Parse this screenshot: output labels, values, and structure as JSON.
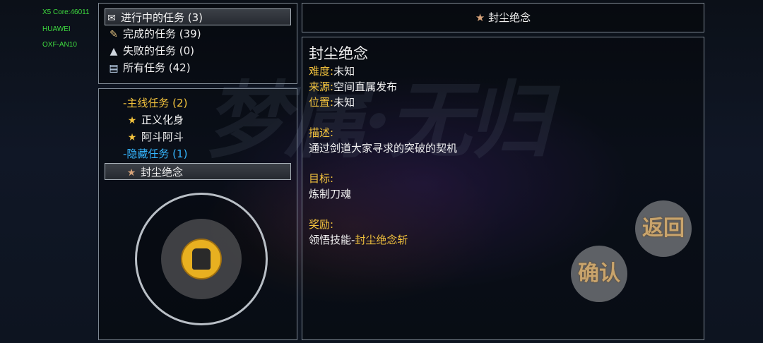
{
  "device": {
    "line1": "X5 Core:46011",
    "line2": "HUAWEI",
    "line3": "OXF-AN10"
  },
  "background_title": "梦属·无归",
  "filters": [
    {
      "label": "进行中的任务 (3)",
      "icon": "scroll-icon",
      "selected": true
    },
    {
      "label": "完成的任务 (39)",
      "icon": "rolled-scroll-icon",
      "selected": false
    },
    {
      "label": "失败的任务 (0)",
      "icon": "flask-icon",
      "selected": false
    },
    {
      "label": "所有任务 (42)",
      "icon": "book-icon",
      "selected": false
    }
  ],
  "quest_tree": {
    "main_group": "-主线任务 (2)",
    "main_items": [
      "正义化身",
      "阿斗阿斗"
    ],
    "hidden_group": "-隐藏任务 (1)",
    "hidden_items": [
      "封尘绝念"
    ]
  },
  "header": {
    "title": "封尘绝念"
  },
  "detail": {
    "title": "封尘绝念",
    "difficulty_label": "难度:",
    "difficulty_value": "未知",
    "source_label": "来源:",
    "source_value": "空间直属发布",
    "location_label": "位置:",
    "location_value": "未知",
    "description_label": "描述:",
    "description_value": "通过剑道大家寻求的突破的契机",
    "objective_label": "目标:",
    "objective_value": "炼制刀魂",
    "reward_label": "奖励:",
    "reward_prefix": "领悟技能-",
    "reward_skill": "封尘绝念斩"
  },
  "buttons": {
    "back": "返回",
    "confirm": "确认"
  },
  "colors": {
    "accent_gold": "#f2c23d",
    "accent_blue": "#35b6ff",
    "device_green": "#3fdc3f"
  }
}
